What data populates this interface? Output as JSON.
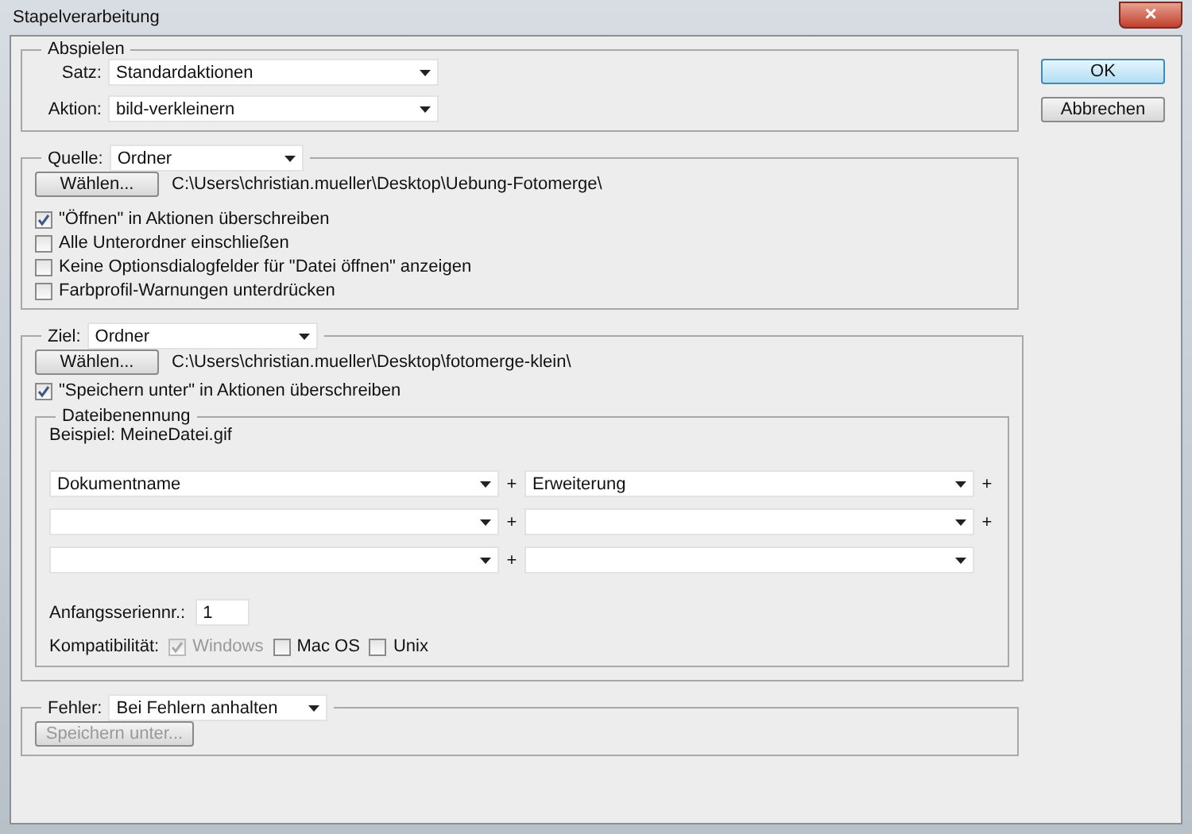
{
  "window": {
    "title": "Stapelverarbeitung",
    "close": "×"
  },
  "buttons": [
    {
      "label": "OK",
      "default": true
    },
    {
      "label": "Abbrechen",
      "default": false
    }
  ],
  "play": {
    "legend": "Abspielen",
    "fields": [
      {
        "label": "Satz:",
        "value": "Standardaktionen"
      },
      {
        "label": "Aktion:",
        "value": "bild-verkleinern"
      }
    ]
  },
  "source": {
    "label": "Quelle:",
    "value": "Ordner",
    "choose": "Wählen...",
    "path": "C:\\Users\\christian.mueller\\Desktop\\Uebung-Fotomerge\\",
    "options": [
      {
        "label": "\"Öffnen\" in Aktionen überschreiben",
        "checked": true
      },
      {
        "label": "Alle Unterordner einschließen",
        "checked": false
      },
      {
        "label": "Keine Optionsdialogfelder für \"Datei öffnen\" anzeigen",
        "checked": false
      },
      {
        "label": "Farbprofil-Warnungen unterdrücken",
        "checked": false
      }
    ]
  },
  "target": {
    "label": "Ziel:",
    "value": "Ordner",
    "choose": "Wählen...",
    "path": "C:\\Users\\christian.mueller\\Desktop\\fotomerge-klein\\",
    "override": {
      "label": "\"Speichern unter\" in Aktionen überschreiben",
      "checked": true
    },
    "naming": {
      "legend": "Dateibenennung",
      "example": "Beispiel: MeineDatei.gif",
      "rows": [
        {
          "left": {
            "value": "Dokumentname",
            "plus": "+"
          },
          "right": {
            "value": "Erweiterung",
            "plus": "+"
          }
        },
        {
          "left": {
            "plus": "+"
          },
          "right": {
            "plus": "+"
          }
        },
        {
          "left": {
            "plus": "+"
          },
          "right": {}
        }
      ],
      "serial_label": "Anfangsseriennr.:",
      "serial_value": "1",
      "compat_label": "Kompatibilität:",
      "compat": [
        {
          "label": "Windows",
          "checked": true,
          "disabled": true
        },
        {
          "label": "Mac OS",
          "checked": false,
          "disabled": false
        },
        {
          "label": "Unix",
          "checked": false,
          "disabled": false
        }
      ]
    }
  },
  "errors": {
    "label": "Fehler:",
    "value": "Bei Fehlern anhalten",
    "save_as": {
      "label": "Speichern unter...",
      "disabled": true
    }
  }
}
